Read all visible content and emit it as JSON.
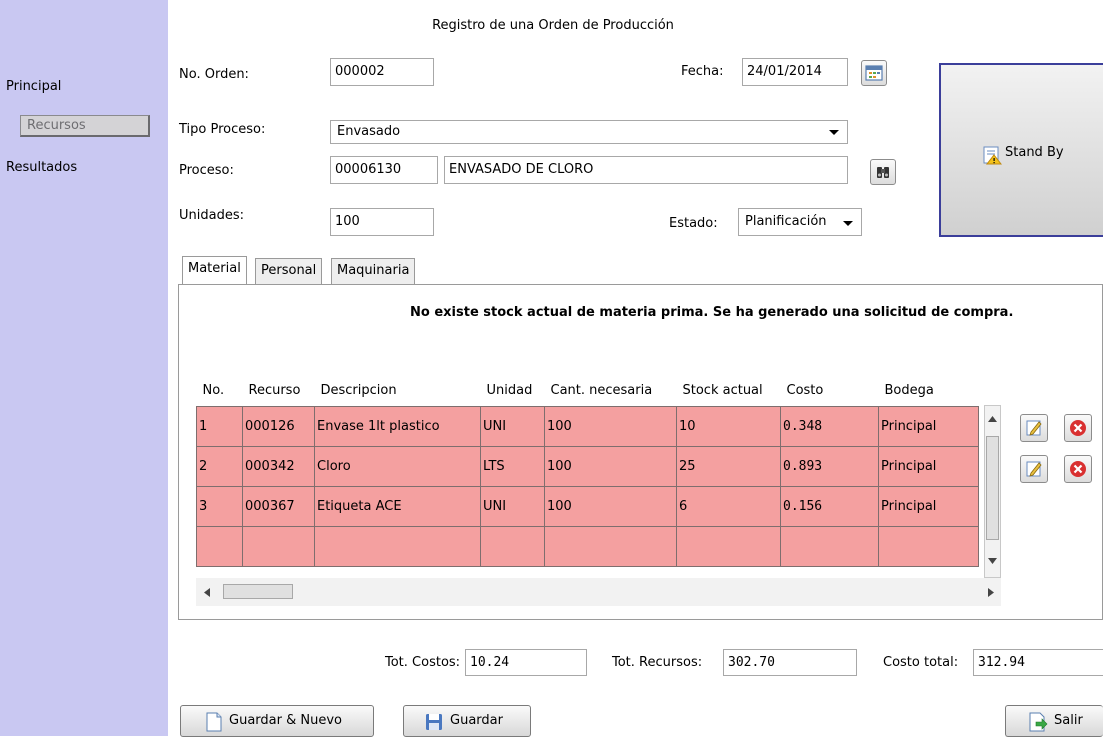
{
  "window": {
    "title": "Registro de una Orden de Producción"
  },
  "sidebar": {
    "items": [
      {
        "label": "Principal"
      },
      {
        "label": "Recursos"
      },
      {
        "label": "Resultados"
      }
    ]
  },
  "form": {
    "orden_label": "No. Orden:",
    "orden_value": "000002",
    "fecha_label": "Fecha:",
    "fecha_value": "24/01/2014",
    "tipo_label": "Tipo Proceso:",
    "tipo_value": "Envasado",
    "proceso_label": "Proceso:",
    "proceso_code": "00006130",
    "proceso_name": "ENVASADO DE CLORO",
    "unidades_label": "Unidades:",
    "unidades_value": "100",
    "estado_label": "Estado:",
    "estado_value": "Planificación"
  },
  "standby": {
    "label": "Stand By"
  },
  "tabs": [
    {
      "label": "Material"
    },
    {
      "label": "Personal"
    },
    {
      "label": "Maquinaria"
    }
  ],
  "message": "No existe stock actual de materia prima. Se ha generado una solicitud de compra.",
  "table": {
    "columns": [
      "No.",
      "Recurso",
      "Descripcion",
      "Unidad",
      "Cant. necesaria",
      "Stock actual",
      "Costo",
      "Bodega"
    ],
    "rows": [
      [
        "1",
        "000126",
        "Envase 1lt plastico",
        "UNI",
        "100",
        "10",
        "0.348",
        "Principal"
      ],
      [
        "2",
        "000342",
        "Cloro",
        "LTS",
        "100",
        "25",
        "0.893",
        "Principal"
      ],
      [
        "3",
        "000367",
        "Etiqueta ACE",
        "UNI",
        "100",
        "6",
        "0.156",
        "Principal"
      ],
      [
        "",
        "",
        "",
        "",
        "",
        "",
        "",
        ""
      ]
    ]
  },
  "totals": {
    "costos_label": "Tot. Costos:",
    "costos_value": "10.24",
    "recursos_label": "Tot. Recursos:",
    "recursos_value": "302.70",
    "total_label": "Costo total:",
    "total_value": "312.94"
  },
  "buttons": {
    "guardar_nuevo": "Guardar & Nuevo",
    "guardar": "Guardar",
    "salir": "Salir"
  },
  "colors": {
    "sidebar": "#c9c8f2",
    "row_error": "#f4a0a0",
    "standby_border": "#3b3e9a"
  }
}
